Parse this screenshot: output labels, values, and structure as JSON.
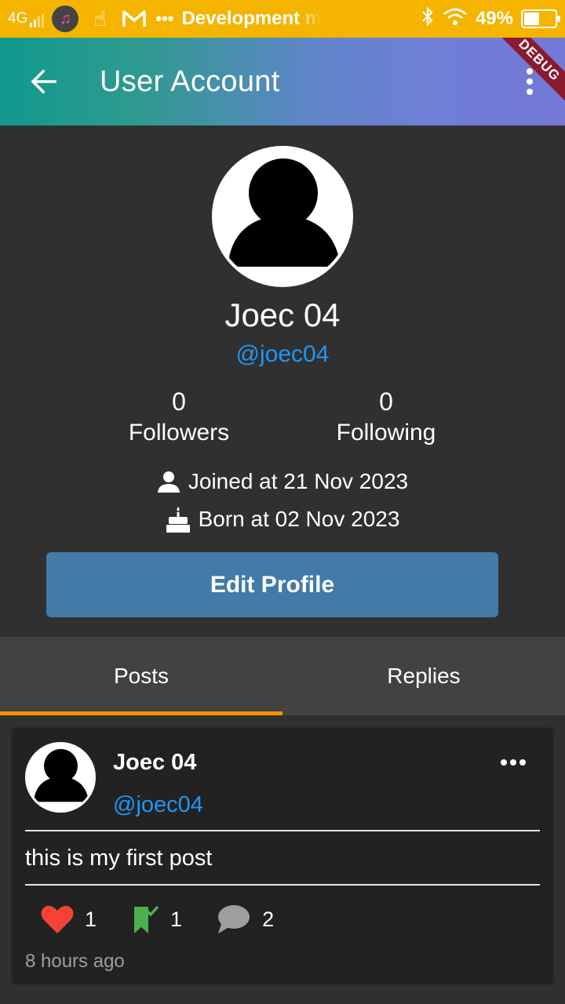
{
  "status_bar": {
    "network": "4G",
    "notification_text": "Development mode",
    "battery": "49%",
    "battery_level": 0.49,
    "icons": [
      "music-icon",
      "touchpal-icon",
      "gmail-icon",
      "more-dots-icon",
      "bluetooth-icon",
      "wifi-icon",
      "battery-charging-icon"
    ]
  },
  "app_bar": {
    "title": "User Account",
    "debug_banner": "DEBUG",
    "gradient": [
      "#11998e",
      "#7478d6"
    ]
  },
  "profile": {
    "display_name": "Joec 04",
    "handle": "@joec04",
    "followers_count": "0",
    "followers_label": "Followers",
    "following_count": "0",
    "following_label": "Following",
    "joined": "Joined at 21 Nov 2023",
    "born": "Born at 02 Nov 2023",
    "edit_button": "Edit Profile"
  },
  "tabs": [
    {
      "label": "Posts",
      "active": true
    },
    {
      "label": "Replies",
      "active": false
    }
  ],
  "post": {
    "author_name": "Joec 04",
    "author_handle": "@joec04",
    "text": "this is my first post",
    "likes": "1",
    "bookmarks": "1",
    "comments": "2",
    "time": "8 hours ago"
  },
  "colors": {
    "accent_link": "#2196f3",
    "tab_indicator": "#ff8f00",
    "edit_button": "#427aa8",
    "status_bar": "#f4b400",
    "like": "#f44336",
    "bookmark": "#4caf50"
  }
}
